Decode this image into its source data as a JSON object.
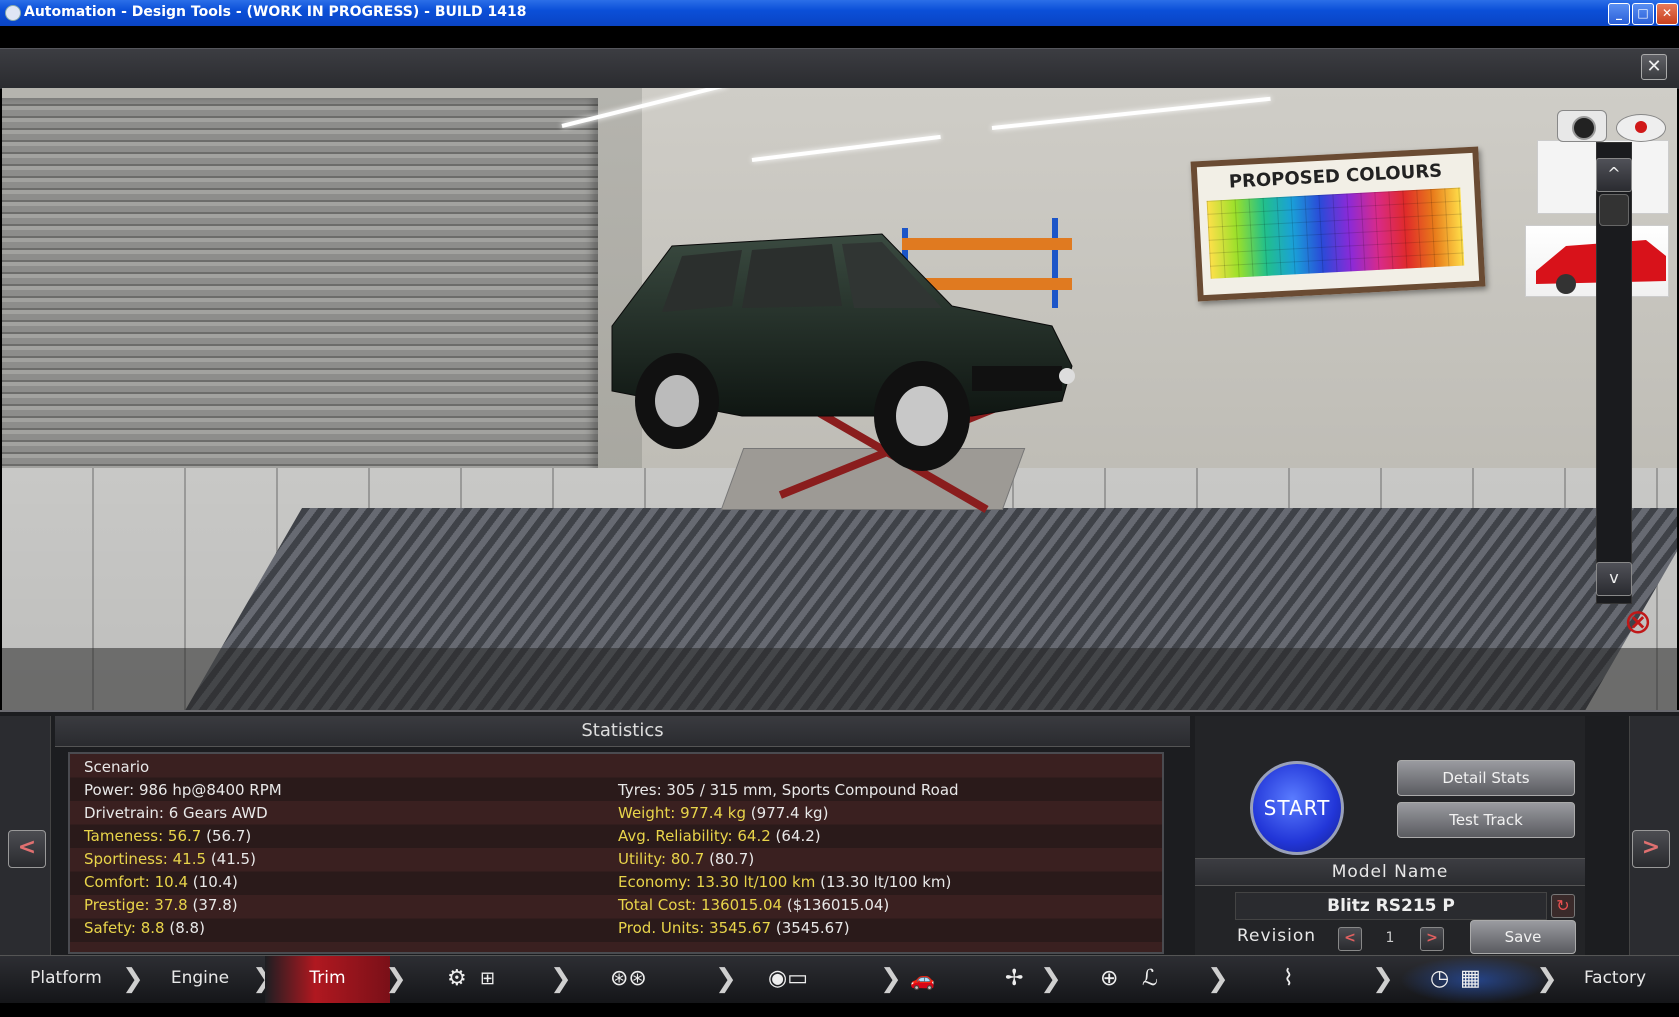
{
  "window": {
    "title": "Automation - Design Tools - (WORK IN PROGRESS) - BUILD 1418"
  },
  "scene": {
    "poster_title": "PROPOSED COLOURS",
    "close_label": "X"
  },
  "gallery": {
    "up_label": "^",
    "down_label": "v"
  },
  "statistics": {
    "title": "Statistics",
    "scenario": "Scenario",
    "left": [
      {
        "label": "Power:",
        "value": "986 hp@8400 RPM",
        "highlight": false
      },
      {
        "label": "Drivetrain:",
        "value": "6 Gears AWD",
        "highlight": false
      },
      {
        "label": "Tameness:",
        "value": "56.7",
        "extra": "(56.7)",
        "highlight": true
      },
      {
        "label": "Sportiness:",
        "value": "41.5",
        "extra": "(41.5)",
        "highlight": true
      },
      {
        "label": "Comfort:",
        "value": "10.4",
        "extra": "(10.4)",
        "highlight": true
      },
      {
        "label": "Prestige:",
        "value": "37.8",
        "extra": "(37.8)",
        "highlight": true
      },
      {
        "label": "Safety:",
        "value": "8.8",
        "extra": "(8.8)",
        "highlight": true
      }
    ],
    "right": [
      {
        "label": "Tyres:",
        "value": "305 / 315 mm, Sports Compound Road",
        "highlight": false
      },
      {
        "label": "Weight:",
        "value": "977.4 kg",
        "extra": "(977.4 kg)",
        "highlight": true
      },
      {
        "label": "Avg. Reliability:",
        "value": "64.2",
        "extra": "(64.2)",
        "highlight": true
      },
      {
        "label": "Utility:",
        "value": "80.7",
        "extra": "(80.7)",
        "highlight": true
      },
      {
        "label": "Economy:",
        "value": "13.30 lt/100 km",
        "extra": "(13.30 lt/100 km)",
        "highlight": true
      },
      {
        "label": "Total Cost:",
        "value": "136015.04",
        "extra": "($136015.04)",
        "highlight": true
      },
      {
        "label": "Prod. Units:",
        "value": "3545.67",
        "extra": "(3545.67)",
        "highlight": true
      }
    ]
  },
  "actions": {
    "start_label": "START",
    "detail_stats_label": "Detail Stats",
    "test_track_label": "Test Track",
    "model_name_label": "Model Name",
    "model_name_value": "Blitz RS215 P",
    "revision_label": "Revision",
    "revision_value": "1",
    "save_label": "Save"
  },
  "side_nav": {
    "prev_label": "<",
    "next_label": ">"
  },
  "navbar": {
    "items": [
      "Platform",
      "Engine",
      "Trim",
      "Factory"
    ],
    "active": "Trim"
  },
  "colors": {
    "accent_red": "#b01820",
    "highlight_yellow": "#e8d44a",
    "start_blue": "#2236d8",
    "titlebar_blue": "#0b4fd8"
  }
}
